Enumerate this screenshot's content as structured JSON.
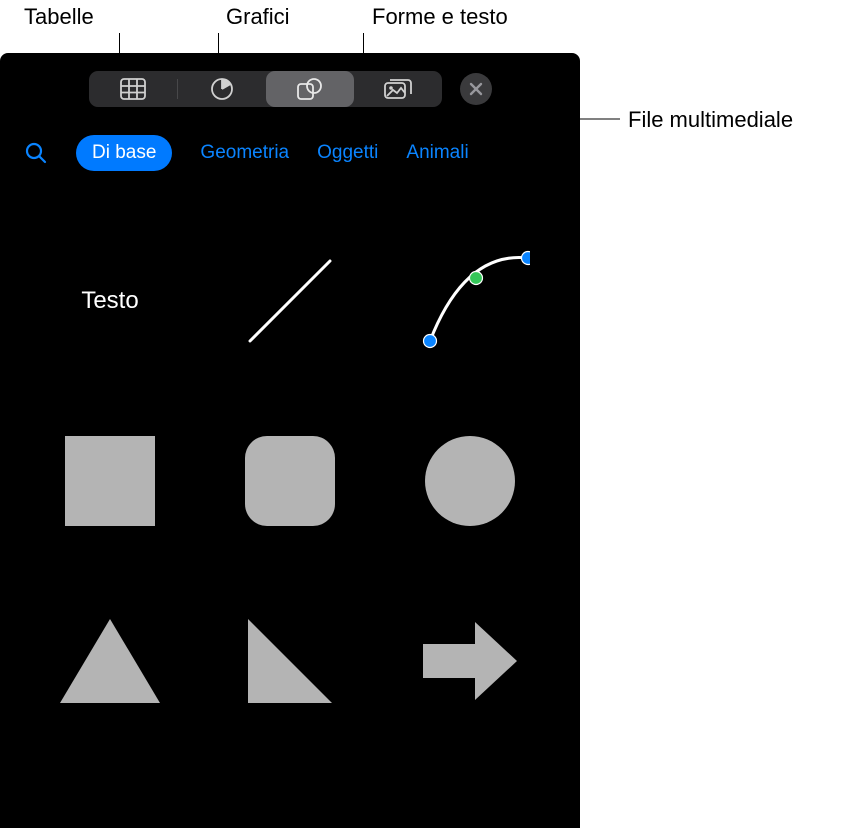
{
  "callouts": {
    "tables": "Tabelle",
    "charts": "Grafici",
    "shapes_text": "Forme e testo",
    "media": "File multimediale"
  },
  "categories": {
    "basic": "Di base",
    "geometry": "Geometria",
    "objects": "Oggetti",
    "animals": "Animali"
  },
  "shapes": {
    "text_label": "Testo"
  },
  "colors": {
    "accent": "#007aff",
    "link": "#0a84ff",
    "shape_fill": "#b4b4b4",
    "bezier_blue": "#0a84ff",
    "bezier_green": "#34c759"
  }
}
